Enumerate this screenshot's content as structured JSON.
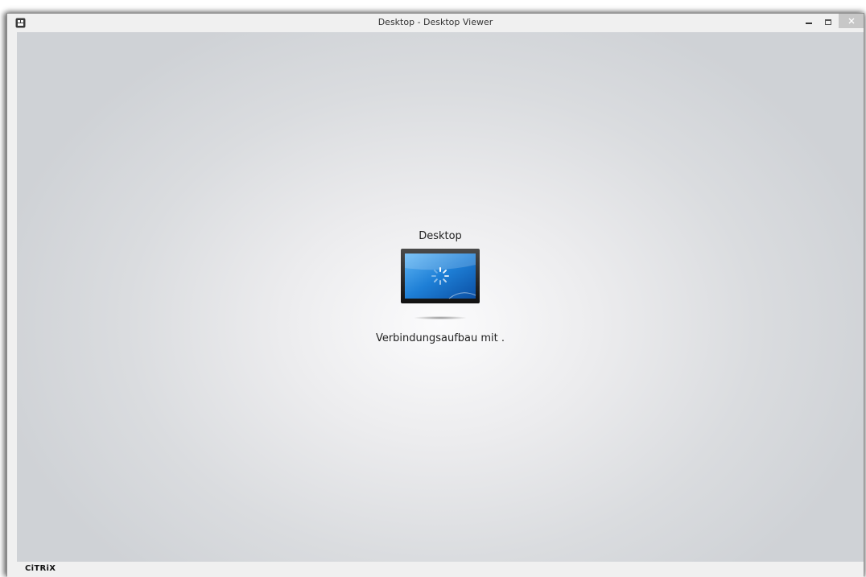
{
  "window": {
    "title": "Desktop - Desktop Viewer",
    "minimize_glyph": "–",
    "maximize_glyph": "□",
    "close_glyph": "×"
  },
  "main": {
    "heading": "Desktop",
    "status": "Verbindungsaufbau mit .",
    "icon": "monitor-loading-icon"
  },
  "footer": {
    "brand": "CiTRiX"
  },
  "colors": {
    "screen_blue": "#1e7fd6",
    "close_button": "#c7c7c7"
  }
}
